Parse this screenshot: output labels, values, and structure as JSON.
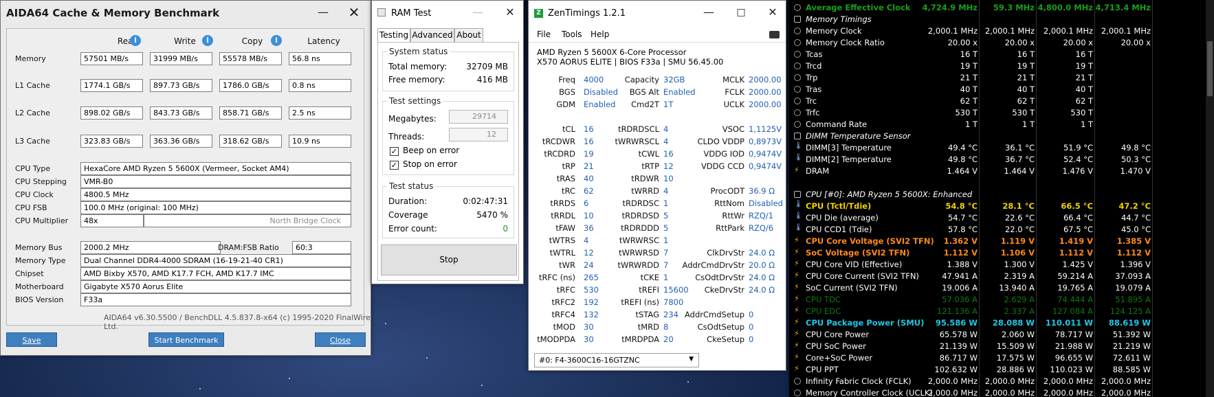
{
  "aida": {
    "title": "AIDA64 Cache & Memory Benchmark",
    "headers": [
      "Read",
      "Write",
      "Copy",
      "Latency"
    ],
    "rows": [
      {
        "label": "Memory",
        "read": "57501 MB/s",
        "write": "31999 MB/s",
        "copy": "55578 MB/s",
        "lat": "56.8 ns"
      },
      {
        "label": "L1 Cache",
        "read": "1774.1 GB/s",
        "write": "897.73 GB/s",
        "copy": "1786.0 GB/s",
        "lat": "0.8 ns"
      },
      {
        "label": "L2 Cache",
        "read": "898.02 GB/s",
        "write": "843.73 GB/s",
        "copy": "858.71 GB/s",
        "lat": "2.5 ns"
      },
      {
        "label": "L3 Cache",
        "read": "323.83 GB/s",
        "write": "363.36 GB/s",
        "copy": "318.62 GB/s",
        "lat": "10.9 ns"
      }
    ],
    "cpu_type_label": "CPU Type",
    "cpu_type": "HexaCore AMD Ryzen 5 5600X  (Vermeer, Socket AM4)",
    "cpu_stepping_label": "CPU Stepping",
    "cpu_stepping": "VMR-B0",
    "cpu_clock_label": "CPU Clock",
    "cpu_clock": "4800.5 MHz",
    "cpu_fsb_label": "CPU FSB",
    "cpu_fsb": "100.0 MHz  (original: 100 MHz)",
    "cpu_mult_label": "CPU Multiplier",
    "cpu_mult": "48x",
    "nb_clock_label": "North Bridge Clock",
    "mem_bus_label": "Memory Bus",
    "mem_bus": "2000.2 MHz",
    "dram_ratio_label": "DRAM:FSB Ratio",
    "dram_ratio": "60:3",
    "mem_type_label": "Memory Type",
    "mem_type": "Dual Channel DDR4-4000 SDRAM  (16-19-21-40 CR1)",
    "chipset_label": "Chipset",
    "chipset": "AMD Bixby X570, AMD K17.7 FCH, AMD K17.7 IMC",
    "mobo_label": "Motherboard",
    "mobo": "Gigabyte X570 Aorus Elite",
    "bios_label": "BIOS Version",
    "bios": "F33a",
    "footer": "AIDA64 v6.30.5500 / BenchDLL 4.5.837.8-x64  (c) 1995-2020 FinalWire Ltd.",
    "save": "Save",
    "start": "Start Benchmark",
    "close": "Close"
  },
  "ram": {
    "title": "RAM Test",
    "tabs": [
      "Testing",
      "Advanced",
      "About"
    ],
    "sys_status": "System status",
    "total_mem_label": "Total memory:",
    "total_mem": "32709 MB",
    "free_mem_label": "Free memory:",
    "free_mem": "416 MB",
    "settings": "Test settings",
    "mb_label": "Megabytes:",
    "mb": "29714",
    "threads_label": "Threads:",
    "threads": "12",
    "beep": "Beep on error",
    "stop_err": "Stop on error",
    "test_status": "Test status",
    "duration_label": "Duration:",
    "duration": "0:02:47:31",
    "coverage_label": "Coverage",
    "coverage": "5470 %",
    "errors_label": "Error count:",
    "errors": "0",
    "stop": "Stop"
  },
  "zen": {
    "title": "ZenTimings 1.2.1",
    "menu": [
      "File",
      "Tools",
      "Help"
    ],
    "cpu": "AMD Ryzen 5 5600X 6-Core Processor",
    "board": "X570 AORUS ELITE | BIOS F33a | SMU 56.45.00",
    "top": [
      [
        "Freq",
        "4000",
        "Capacity",
        "32GB",
        "MCLK",
        "2000.00"
      ],
      [
        "BGS",
        "Disabled",
        "BGS Alt",
        "Enabled",
        "FCLK",
        "2000.00"
      ],
      [
        "GDM",
        "Enabled",
        "Cmd2T",
        "1T",
        "UCLK",
        "2000.00"
      ]
    ],
    "timings": [
      [
        "tCL",
        "16",
        "tRDRDSCL",
        "4",
        "VSOC",
        "1,1125V"
      ],
      [
        "tRCDWR",
        "16",
        "tWRWRSCL",
        "4",
        "CLDO VDDP",
        "0,8973V"
      ],
      [
        "tRCDRD",
        "19",
        "tCWL",
        "16",
        "VDDG IOD",
        "0,9474V"
      ],
      [
        "tRP",
        "21",
        "tRTP",
        "12",
        "VDDG CCD",
        "0,9474V"
      ],
      [
        "tRAS",
        "40",
        "tRDWR",
        "10",
        "",
        ""
      ],
      [
        "tRC",
        "62",
        "tWRRD",
        "4",
        "ProcODT",
        "36.9 Ω"
      ],
      [
        "tRRDS",
        "6",
        "tRDRDSC",
        "1",
        "RttNom",
        "Disabled"
      ],
      [
        "tRRDL",
        "10",
        "tRDRDSD",
        "5",
        "RttWr",
        "RZQ/1"
      ],
      [
        "tFAW",
        "36",
        "tRDRDDD",
        "5",
        "RttPark",
        "RZQ/6"
      ],
      [
        "tWTRS",
        "4",
        "tWRWRSC",
        "1",
        "",
        ""
      ],
      [
        "tWTRL",
        "12",
        "tWRWRSD",
        "7",
        "ClkDrvStr",
        "24.0 Ω"
      ],
      [
        "tWR",
        "24",
        "tWRWRDD",
        "7",
        "AddrCmdDrvStr",
        "20.0 Ω"
      ],
      [
        "tRFC (ns)",
        "265",
        "tCKE",
        "1",
        "CsOdtDrvStr",
        "24.0 Ω"
      ],
      [
        "tRFC",
        "530",
        "tREFI",
        "15600",
        "CkeDrvStr",
        "24.0 Ω"
      ],
      [
        "tRFC2",
        "192",
        "tREFI (ns)",
        "7800",
        "",
        ""
      ],
      [
        "tRFC4",
        "132",
        "tSTAG",
        "234",
        "AddrCmdSetup",
        "0"
      ],
      [
        "tMOD",
        "30",
        "tMRD",
        "8",
        "CsOdtSetup",
        "0"
      ],
      [
        "tMODPDA",
        "30",
        "tMRDPDA",
        "20",
        "CkeSetup",
        "0"
      ]
    ],
    "profile": "#0: F4-3600C16-16GTZNC"
  },
  "hw": {
    "rows": [
      {
        "n": "Average Effective Clock",
        "v": [
          "4,724.9 MHz",
          "59.3 MHz",
          "4,800.0 MHz",
          "4,713.4 MHz"
        ],
        "col": "#18a018",
        "bold": true,
        "icon": "clock"
      },
      {
        "n": "Memory Timings",
        "hdr": true,
        "icon": "chip"
      },
      {
        "n": "Memory Clock",
        "v": [
          "2,000.1 MHz",
          "2,000.1 MHz",
          "2,000.1 MHz",
          "2,000.1 MHz"
        ],
        "icon": "clock"
      },
      {
        "n": "Memory Clock Ratio",
        "v": [
          "20.00 x",
          "20.00 x",
          "20.00 x",
          "20.00 x"
        ],
        "icon": "clock"
      },
      {
        "n": "Tcas",
        "v": [
          "16 T",
          "16 T",
          "16 T",
          ""
        ],
        "icon": "clock"
      },
      {
        "n": "Trcd",
        "v": [
          "19 T",
          "19 T",
          "19 T",
          ""
        ],
        "icon": "clock"
      },
      {
        "n": "Trp",
        "v": [
          "21 T",
          "21 T",
          "21 T",
          ""
        ],
        "icon": "clock"
      },
      {
        "n": "Tras",
        "v": [
          "40 T",
          "40 T",
          "40 T",
          ""
        ],
        "icon": "clock"
      },
      {
        "n": "Trc",
        "v": [
          "62 T",
          "62 T",
          "62 T",
          ""
        ],
        "icon": "clock"
      },
      {
        "n": "Trfc",
        "v": [
          "530 T",
          "530 T",
          "530 T",
          ""
        ],
        "icon": "clock"
      },
      {
        "n": "Command Rate",
        "v": [
          "1 T",
          "1 T",
          "1 T",
          ""
        ],
        "icon": "clock"
      },
      {
        "n": "DIMM Temperature Sensor",
        "hdr": true,
        "icon": "chip"
      },
      {
        "n": "DIMM[3] Temperature",
        "v": [
          "49.4 °C",
          "36.1 °C",
          "51.9 °C",
          "49.8 °C"
        ],
        "icon": "temp"
      },
      {
        "n": "DIMM[2] Temperature",
        "v": [
          "49.8 °C",
          "36.7 °C",
          "52.4 °C",
          "50.3 °C"
        ],
        "icon": "temp"
      },
      {
        "n": "DRAM",
        "v": [
          "1.464 V",
          "1.464 V",
          "1.476 V",
          "1.470 V"
        ],
        "icon": "volt"
      },
      {
        "n": "",
        "blank": true
      },
      {
        "n": "CPU [#0]: AMD Ryzen 5 5600X: Enhanced",
        "hdr": true,
        "icon": "chip"
      },
      {
        "n": "CPU (Tctl/Tdie)",
        "v": [
          "54.8 °C",
          "28.1 °C",
          "66.5 °C",
          "47.2 °C"
        ],
        "col": "#f0d200",
        "bold": true,
        "icon": "temp"
      },
      {
        "n": "CPU Die (average)",
        "v": [
          "54.7 °C",
          "22.6 °C",
          "66.4 °C",
          "44.7 °C"
        ],
        "icon": "temp"
      },
      {
        "n": "CPU CCD1 (Tdie)",
        "v": [
          "57.8 °C",
          "22.0 °C",
          "67.5 °C",
          "45.0 °C"
        ],
        "icon": "temp"
      },
      {
        "n": "CPU Core Voltage (SVI2 TFN)",
        "v": [
          "1.362 V",
          "1.119 V",
          "1.419 V",
          "1.385 V"
        ],
        "col": "#ff8a1a",
        "bold": true,
        "icon": "volt"
      },
      {
        "n": "SoC Voltage (SVI2 TFN)",
        "v": [
          "1.112 V",
          "1.106 V",
          "1.112 V",
          "1.112 V"
        ],
        "col": "#ff8a1a",
        "bold": true,
        "icon": "volt"
      },
      {
        "n": "CPU Core VID (Effective)",
        "v": [
          "1.388 V",
          "1.300 V",
          "1.425 V",
          "1.396 V"
        ],
        "icon": "volt"
      },
      {
        "n": "CPU Core Current (SVI2 TFN)",
        "v": [
          "47.941 A",
          "2.319 A",
          "59.214 A",
          "37.093 A"
        ],
        "icon": "volt"
      },
      {
        "n": "SoC Current (SVI2 TFN)",
        "v": [
          "19.006 A",
          "13.940 A",
          "19.765 A",
          "19.079 A"
        ],
        "icon": "volt"
      },
      {
        "n": "CPU TDC",
        "v": [
          "57.036 A",
          "2.629 A",
          "74.444 A",
          "51.895 A"
        ],
        "col": "#0d7a0d",
        "icon": "volt"
      },
      {
        "n": "CPU EDC",
        "v": [
          "121.136 A",
          "2.337 A",
          "127.084 A",
          "124.125 A"
        ],
        "col": "#0d7a0d",
        "icon": "volt"
      },
      {
        "n": "CPU Package Power (SMU)",
        "v": [
          "95.586 W",
          "28.088 W",
          "110.011 W",
          "88.619 W"
        ],
        "col": "#1ec8e8",
        "bold": true,
        "icon": "volt"
      },
      {
        "n": "CPU Core Power",
        "v": [
          "65.578 W",
          "2.060 W",
          "78.717 W",
          "51.392 W"
        ],
        "icon": "volt"
      },
      {
        "n": "CPU SoC Power",
        "v": [
          "21.139 W",
          "15.509 W",
          "21.988 W",
          "21.219 W"
        ],
        "icon": "volt"
      },
      {
        "n": "Core+SoC Power",
        "v": [
          "86.717 W",
          "17.575 W",
          "96.655 W",
          "72.611 W"
        ],
        "icon": "volt"
      },
      {
        "n": "CPU PPT",
        "v": [
          "102.632 W",
          "28.886 W",
          "110.023 W",
          "88.585 W"
        ],
        "icon": "volt"
      },
      {
        "n": "Infinity Fabric Clock (FCLK)",
        "v": [
          "2,000.0 MHz",
          "2,000.0 MHz",
          "2,000.0 MHz",
          "2,000.0 MHz"
        ],
        "icon": "clock"
      },
      {
        "n": "Memory Controller Clock (UCLK)",
        "v": [
          "2,000.0 MHz",
          "2,000.0 MHz",
          "2,000.0 MHz",
          "2,000.0 MHz"
        ],
        "icon": "clock"
      }
    ]
  }
}
